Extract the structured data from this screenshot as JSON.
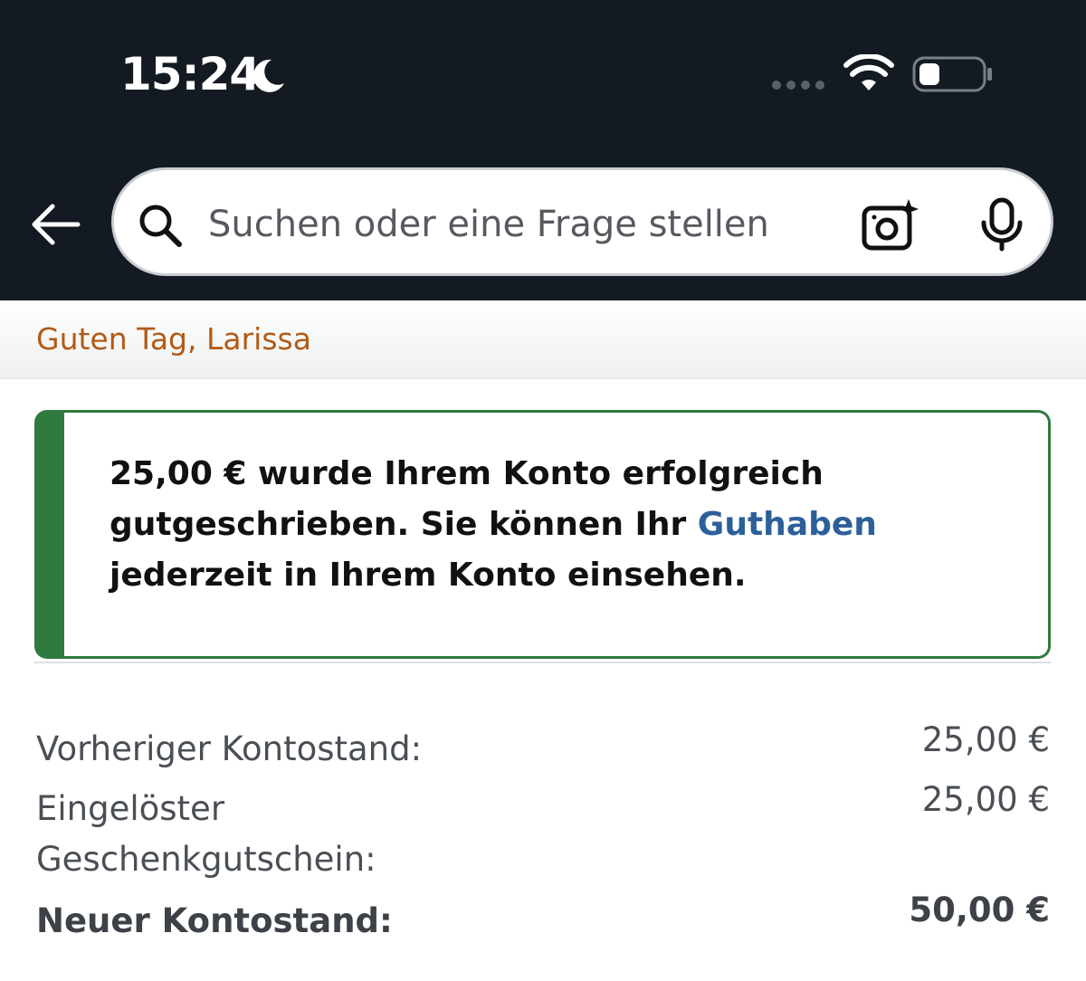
{
  "status_bar": {
    "time": "15:24"
  },
  "search": {
    "placeholder": "Suchen oder eine Frage stellen"
  },
  "greeting": "Guten Tag, Larissa",
  "alert": {
    "text_before": "25,00 € wurde Ihrem Konto erfolgreich gutgeschrieben. Sie können Ihr ",
    "link": "Guthaben",
    "text_after": " jederzeit in Ihrem Konto einsehen."
  },
  "balance": {
    "previous_label": "Vorheriger Kontostand:",
    "previous_value": "25,00 €",
    "redeemed_label": "Eingelöster Geschenkgutschein:",
    "redeemed_value": "25,00 €",
    "new_label": "Neuer Kontostand:",
    "new_value": "50,00 €"
  },
  "colors": {
    "header_bg": "#131a22",
    "greeting": "#b35a14",
    "success_border": "#2f7a3e",
    "link": "#2d5f9a"
  },
  "icons": [
    "moon-icon",
    "signal-dots-icon",
    "wifi-icon",
    "battery-icon",
    "back-arrow-icon",
    "search-icon",
    "camera-icon",
    "mic-icon"
  ]
}
